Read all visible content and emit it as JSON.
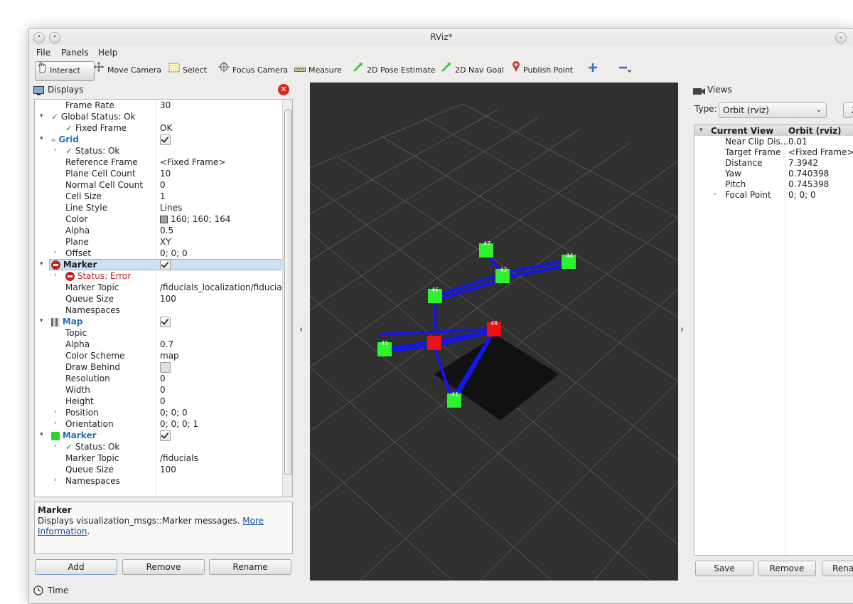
{
  "window": {
    "title": "RViz*"
  },
  "menu": [
    "File",
    "Panels",
    "Help"
  ],
  "toolbar": [
    {
      "label": "Interact",
      "icon": "hand-cursor-icon"
    },
    {
      "label": "Move Camera",
      "icon": "move-camera-icon"
    },
    {
      "label": "Select",
      "icon": "select-box-icon"
    },
    {
      "label": "Focus Camera",
      "icon": "focus-camera-icon"
    },
    {
      "label": "Measure",
      "icon": "ruler-icon"
    },
    {
      "label": "2D Pose Estimate",
      "icon": "green-arrow-icon"
    },
    {
      "label": "2D Nav Goal",
      "icon": "green-arrow-icon"
    },
    {
      "label": "Publish Point",
      "icon": "map-pin-icon"
    }
  ],
  "displays": {
    "title": "Displays",
    "rows": [
      {
        "name": "Frame Rate",
        "value": "30"
      },
      {
        "name": "Global Status: Ok",
        "value": ""
      },
      {
        "name": "Fixed Frame",
        "value": "OK"
      },
      {
        "name": "Grid",
        "value": ""
      },
      {
        "name": "Status: Ok",
        "value": ""
      },
      {
        "name": "Reference Frame",
        "value": "<Fixed Frame>"
      },
      {
        "name": "Plane Cell Count",
        "value": "10"
      },
      {
        "name": "Normal Cell Count",
        "value": "0"
      },
      {
        "name": "Cell Size",
        "value": "1"
      },
      {
        "name": "Line Style",
        "value": "Lines"
      },
      {
        "name": "Color",
        "value": "160; 160; 164"
      },
      {
        "name": "Alpha",
        "value": "0.5"
      },
      {
        "name": "Plane",
        "value": "XY"
      },
      {
        "name": "Offset",
        "value": "0; 0; 0"
      },
      {
        "name": "Marker",
        "value": ""
      },
      {
        "name": "Status: Error",
        "value": ""
      },
      {
        "name": "Marker Topic",
        "value": "/fiducials_localization/fiducials"
      },
      {
        "name": "Queue Size",
        "value": "100"
      },
      {
        "name": "Namespaces",
        "value": ""
      },
      {
        "name": "Map",
        "value": ""
      },
      {
        "name": "Topic",
        "value": ""
      },
      {
        "name": "Alpha",
        "value": "0.7"
      },
      {
        "name": "Color Scheme",
        "value": "map"
      },
      {
        "name": "Draw Behind",
        "value": ""
      },
      {
        "name": "Resolution",
        "value": "0"
      },
      {
        "name": "Width",
        "value": "0"
      },
      {
        "name": "Height",
        "value": "0"
      },
      {
        "name": "Position",
        "value": "0; 0; 0"
      },
      {
        "name": "Orientation",
        "value": "0; 0; 0; 1"
      },
      {
        "name": "Marker",
        "value": ""
      },
      {
        "name": "Status: Ok",
        "value": ""
      },
      {
        "name": "Marker Topic",
        "value": "/fiducials"
      },
      {
        "name": "Queue Size",
        "value": "100"
      },
      {
        "name": "Namespaces",
        "value": ""
      }
    ],
    "desc_title": "Marker",
    "desc_text": "Displays visualization_msgs::Marker messages.",
    "desc_link_1": "More",
    "desc_link_2": "Information",
    "desc_period": ".",
    "buttons": {
      "add": "Add",
      "remove": "Remove",
      "rename": "Rename"
    }
  },
  "scene": {
    "labels": {
      "m47": "47",
      "m44": "44",
      "m43": "43",
      "m46": "46",
      "m48": "48",
      "m45": "45",
      "m41": "41"
    }
  },
  "views": {
    "title": "Views",
    "type_label": "Type:",
    "type_value": "Orbit (rviz)",
    "zero_button": "Z",
    "header_name": "Current View",
    "header_value": "Orbit (rviz)",
    "rows": [
      {
        "name": "Near Clip Dis...",
        "value": "0.01"
      },
      {
        "name": "Target Frame",
        "value": "<Fixed Frame>"
      },
      {
        "name": "Distance",
        "value": "7.3942"
      },
      {
        "name": "Yaw",
        "value": "0.740398"
      },
      {
        "name": "Pitch",
        "value": "0.745398"
      },
      {
        "name": "Focal Point",
        "value": "0; 0; 0"
      }
    ],
    "buttons": {
      "save": "Save",
      "remove": "Remove",
      "rename": "Rena"
    }
  },
  "time": {
    "title": "Time"
  },
  "colors": {
    "grid_bg": "#303030",
    "marker_green": "#33ee33",
    "marker_red": "#ee1111",
    "link_blue": "#1414ee",
    "error_red": "#c41e1e"
  }
}
